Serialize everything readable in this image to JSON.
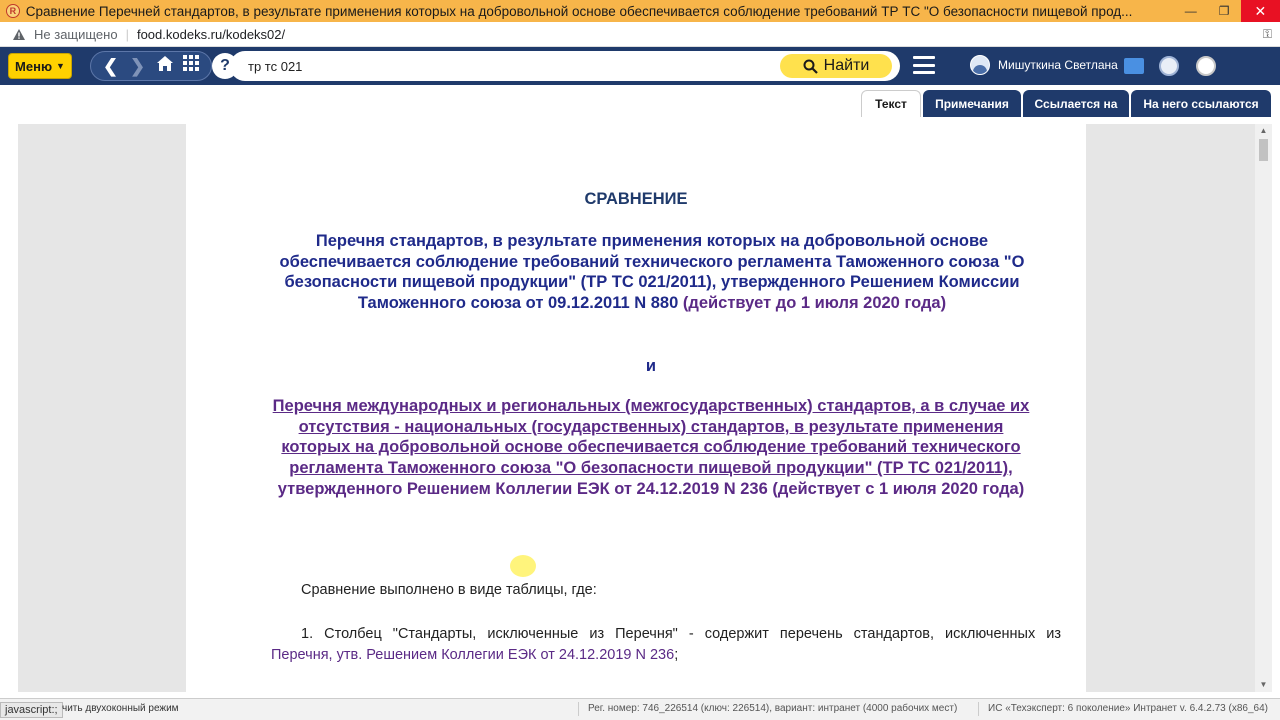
{
  "window": {
    "title": "Сравнение Перечней стандартов, в результате применения которых на добровольной основе обеспечивается соблюдение требований ТР ТС \"О безопасности пищевой прод...",
    "app_icon_letter": "R"
  },
  "address_bar": {
    "security_label": "Не защищено",
    "url": "food.kodeks.ru/kodeks02/"
  },
  "toolbar": {
    "menu_label": "Меню",
    "search_value": "тр тс 021",
    "find_label": "Найти",
    "user_name": "Мишуткина Светлана"
  },
  "tabs": [
    {
      "label": "Текст",
      "active": true
    },
    {
      "label": "Примечания",
      "active": false
    },
    {
      "label": "Ссылается на",
      "active": false
    },
    {
      "label": "На него ссылаются",
      "active": false
    }
  ],
  "document": {
    "heading": "СРАВНЕНИЕ",
    "para1_main": "Перечня стандартов, в результате применения которых на добровольной основе обеспечивается соблюдение требований технического регламента Таможенного союза \"О безопасности пищевой продукции\" (ТР ТС 021/2011), утвержденного Решением Комиссии Таможенного союза от 09.12.2011 N 880",
    "para1_tail": "(действует до 1 июля 2020 года)",
    "and_word": "и",
    "para2_link": "Перечня международных и региональных (межгосударственных) стандартов, а в случае их отсутствия - национальных (государственных) стандартов, в результате применения которых на добровольной основе обеспечивается соблюдение требований технического регламента Таможенного союза \"О безопасности пищевой продукции\" (ТР ТС 021/2011)",
    "para2_rest": ", утвержденного Решением Коллегии ЕЭК от 24.12.2019 N 236",
    "para2_tail": "(действует с 1 июля 2020 года)",
    "body_line1": "Сравнение выполнено в виде таблицы, где:",
    "body_line2": "1. Столбец \"Стандарты, исключенные из Перечня\" - содержит перечень стандартов, исключенных из",
    "body_line3_link": "Перечня, утв. Решением Коллегии ЕЭК от 24.12.2019 N 236",
    "body_line3_end": ";"
  },
  "status_bar": {
    "js_label": "javascript:;",
    "dual_mode": "чить двухоконный режим",
    "registration": "Рег. номер: 746_226514 (ключ: 226514), вариант: интранет (4000 рабочих мест)",
    "version": "ИС «Техэксперт: 6 поколение» Интранет v. 6.4.2.73 (x86_64)"
  },
  "colors": {
    "toolbar_bg": "#1f3a6b",
    "titlebar_bg": "#f7b54a",
    "accent_yellow": "#ffd100",
    "heading_blue": "#1f2a8a",
    "link_purple": "#5b2a86"
  }
}
